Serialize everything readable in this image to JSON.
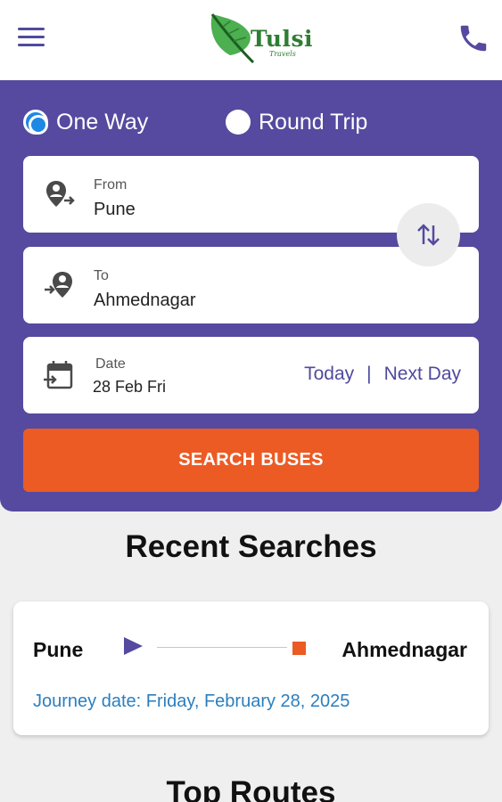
{
  "header": {
    "menu_icon": "hamburger-menu-icon",
    "brand_name": "Tulsi",
    "brand_sub": "Travels",
    "brand_color": "#2e7d32",
    "phone_icon": "phone-icon"
  },
  "trip_type": {
    "options": [
      {
        "label": "One Way",
        "selected": true
      },
      {
        "label": "Round Trip",
        "selected": false
      }
    ]
  },
  "search": {
    "from": {
      "caption": "From",
      "value": "Pune",
      "icon": "location-depart-icon"
    },
    "to": {
      "caption": "To",
      "value": "Ahmednagar",
      "icon": "location-arrive-icon"
    },
    "swap_icon": "swap-vertical-icon",
    "date": {
      "caption": "Date",
      "value": "28 Feb Fri",
      "icon": "calendar-icon",
      "today_label": "Today",
      "separator": "|",
      "next_day_label": "Next Day"
    },
    "button_label": "SEARCH BUSES"
  },
  "recent": {
    "title": "Recent Searches",
    "items": [
      {
        "from": "Pune",
        "to": "Ahmednagar",
        "journey_date": "Journey date: Friday, February 28, 2025"
      }
    ]
  },
  "top_routes": {
    "title": "Top Routes"
  },
  "colors": {
    "primary": "#554a9f",
    "accent": "#ec5b24",
    "radio_selected": "#1e88e5",
    "link": "#2b7fbf",
    "background": "#efefef"
  }
}
